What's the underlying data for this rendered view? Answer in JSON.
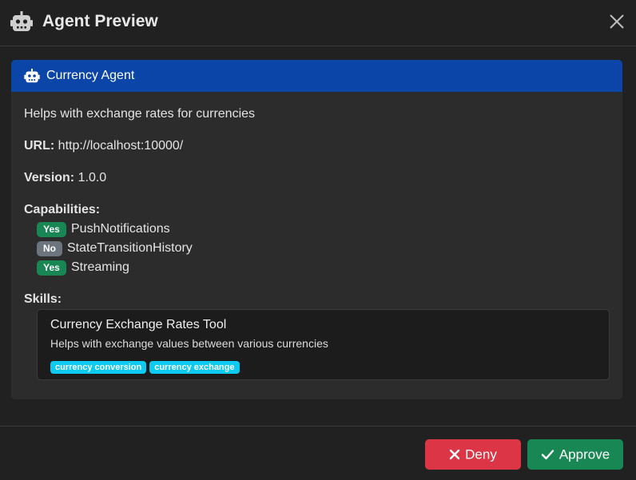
{
  "dialog": {
    "title": "Agent Preview",
    "icon": "robot-icon",
    "close_icon": "close-icon"
  },
  "agent": {
    "name": "Currency Agent",
    "description": "Helps with exchange rates for currencies",
    "url_label": "URL:",
    "url": "http://localhost:10000/",
    "version_label": "Version:",
    "version": "1.0.0",
    "capabilities_label": "Capabilities:",
    "capabilities": [
      {
        "badge": "Yes",
        "name": "PushNotifications",
        "enabled": true
      },
      {
        "badge": "No",
        "name": "StateTransitionHistory",
        "enabled": false
      },
      {
        "badge": "Yes",
        "name": "Streaming",
        "enabled": true
      }
    ],
    "skills_label": "Skills:",
    "skills": [
      {
        "name": "Currency Exchange Rates Tool",
        "description": "Helps with exchange values between various currencies",
        "tags": [
          "currency conversion",
          "currency exchange"
        ]
      }
    ]
  },
  "footer": {
    "deny_label": "Deny",
    "approve_label": "Approve"
  },
  "colors": {
    "header_blue": "#0b45a8",
    "yes_badge": "#198754",
    "no_badge": "#6c757d",
    "tag": "#0dcaf0",
    "deny": "#dc3545",
    "approve": "#198754"
  }
}
